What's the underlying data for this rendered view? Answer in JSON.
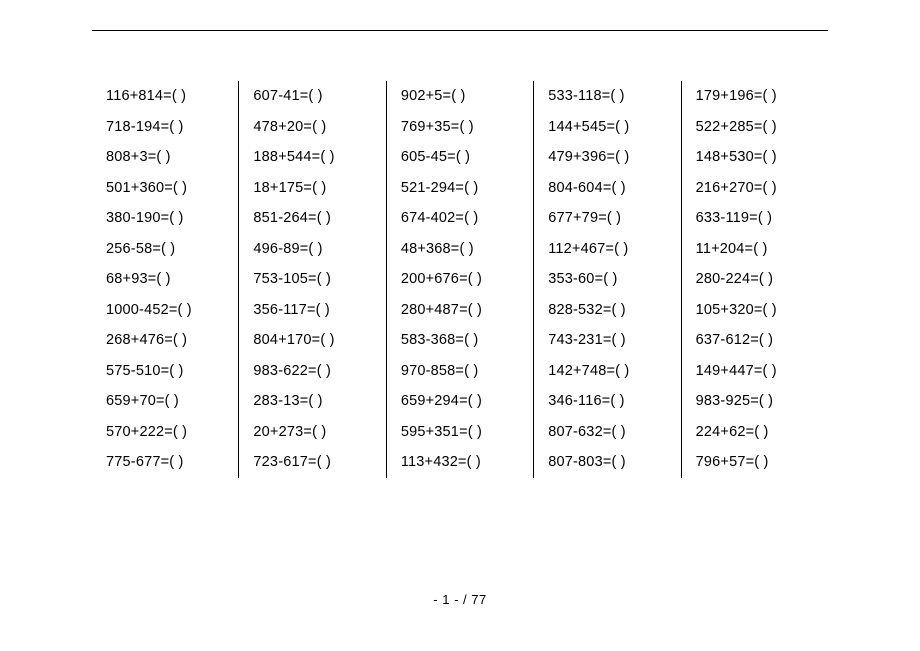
{
  "footer": "- 1 -  / 77",
  "columns": [
    [
      "116+814=(    )",
      "718-194=(    )",
      "808+3=(    )",
      "501+360=(    )",
      "380-190=(    )",
      "256-58=(    )",
      "68+93=(    )",
      "1000-452=(    )",
      "268+476=(    )",
      "575-510=(    )",
      "659+70=(    )",
      "570+222=(    )",
      "775-677=(    )"
    ],
    [
      "607-41=(    )",
      "478+20=(    )",
      "188+544=(    )",
      "18+175=(    )",
      "851-264=(    )",
      "496-89=(    )",
      "753-105=(    )",
      "356-117=(    )",
      "804+170=(    )",
      "983-622=(    )",
      "283-13=(    )",
      "20+273=(    )",
      "723-617=(    )"
    ],
    [
      "902+5=(    )",
      "769+35=(    )",
      "605-45=(    )",
      "521-294=(    )",
      "674-402=(    )",
      "48+368=(    )",
      "200+676=(    )",
      "280+487=(    )",
      "583-368=(    )",
      "970-858=(    )",
      "659+294=(    )",
      "595+351=(    )",
      "113+432=(    )"
    ],
    [
      "533-118=(    )",
      "144+545=(    )",
      "479+396=(    )",
      "804-604=(    )",
      "677+79=(    )",
      "112+467=(    )",
      "353-60=(    )",
      "828-532=(    )",
      "743-231=(    )",
      "142+748=(    )",
      "346-116=(    )",
      "807-632=(    )",
      "807-803=(    )"
    ],
    [
      "179+196=(    )",
      "522+285=(    )",
      "148+530=(    )",
      "216+270=(    )",
      "633-119=(    )",
      "11+204=(    )",
      "280-224=(    )",
      "105+320=(    )",
      "637-612=(    )",
      "149+447=(    )",
      "983-925=(    )",
      "224+62=(    )",
      "796+57=(    )"
    ]
  ]
}
